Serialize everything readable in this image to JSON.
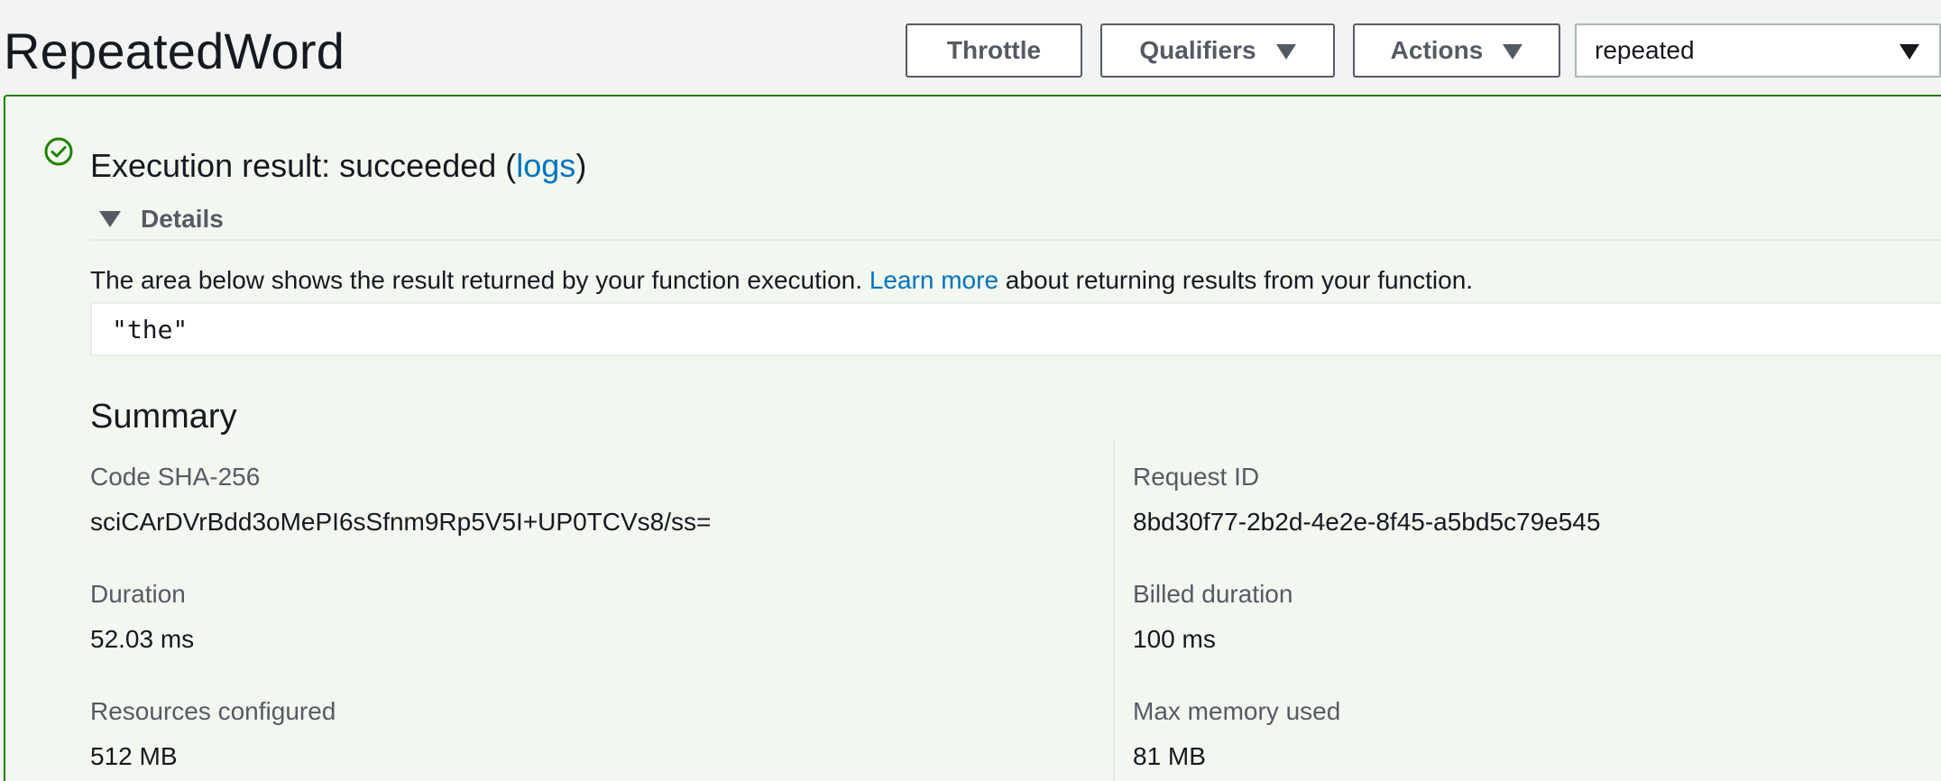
{
  "header": {
    "function_name": "RepeatedWord",
    "throttle_label": "Throttle",
    "qualifiers_label": "Qualifiers",
    "actions_label": "Actions",
    "alias_selected": "repeated"
  },
  "execution": {
    "heading_prefix": "Execution result: succeeded (",
    "logs_link": "logs",
    "heading_suffix": ")",
    "details_label": "Details",
    "desc_prefix": "The area below shows the result returned by your function execution. ",
    "learn_more_link": "Learn more",
    "desc_suffix": " about returning results from your function.",
    "result_value": "\"the\"",
    "status_color": "#1d8102"
  },
  "summary": {
    "title": "Summary",
    "code_sha_label": "Code SHA-256",
    "code_sha_value": "sciCArDVrBdd3oMePI6sSfnm9Rp5V5I+UP0TCVs8/ss=",
    "request_id_label": "Request ID",
    "request_id_value": "8bd30f77-2b2d-4e2e-8f45-a5bd5c79e545",
    "duration_label": "Duration",
    "duration_value": "52.03 ms",
    "billed_label": "Billed duration",
    "billed_value": "100 ms",
    "resources_label": "Resources configured",
    "resources_value": "512 MB",
    "max_memory_label": "Max memory used",
    "max_memory_value": "81 MB"
  },
  "icons": {
    "status": "check-circle-icon",
    "dropdown": "caret-down-icon"
  }
}
